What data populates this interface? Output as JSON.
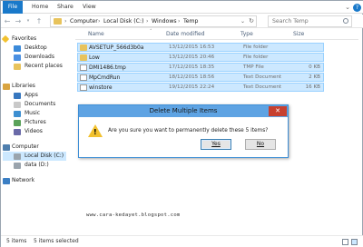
{
  "ribbon": {
    "tabs": [
      "File",
      "Home",
      "Share",
      "View"
    ]
  },
  "nav": {
    "path": [
      "Computer",
      "Local Disk (C:)",
      "Windows",
      "Temp"
    ],
    "search_placeholder": "Search Temp"
  },
  "sidebar": {
    "favorites_label": "Favorites",
    "favorites": [
      "Desktop",
      "Downloads",
      "Recent places"
    ],
    "libraries_label": "Libraries",
    "libraries": [
      "Apps",
      "Documents",
      "Music",
      "Pictures",
      "Videos"
    ],
    "computer_label": "Computer",
    "drives": [
      "Local Disk (C:)",
      "data (D:)"
    ],
    "network_label": "Network"
  },
  "columns": {
    "name": "Name",
    "date": "Date modified",
    "type": "Type",
    "size": "Size"
  },
  "files": [
    {
      "name": "AVSETUP_566d3b0a",
      "date": "13/12/2015 16:53",
      "type": "File folder",
      "size": ""
    },
    {
      "name": "Low",
      "date": "13/12/2015 20:46",
      "type": "File folder",
      "size": ""
    },
    {
      "name": "DMI1486.tmp",
      "date": "17/12/2015 18:35",
      "type": "TMP File",
      "size": "0 KB"
    },
    {
      "name": "MpCmdRun",
      "date": "18/12/2015 18:56",
      "type": "Text Document",
      "size": "2 KB"
    },
    {
      "name": "winstore",
      "date": "19/12/2015 22:24",
      "type": "Text Document",
      "size": "16 KB"
    }
  ],
  "dialog": {
    "title": "Delete Multiple Items",
    "message": "Are you sure you want to permanently delete these 5 items?",
    "yes_label": "Yes",
    "no_label": "No"
  },
  "watermark": "www.cara-kedayet.blogspot.com",
  "status": {
    "count": "5 items",
    "selected": "5 items selected"
  },
  "colors": {
    "accent": "#1979ca",
    "selection": "#cce8ff",
    "dialog_title": "#5ea3e3",
    "close_button": "#c7402f"
  }
}
